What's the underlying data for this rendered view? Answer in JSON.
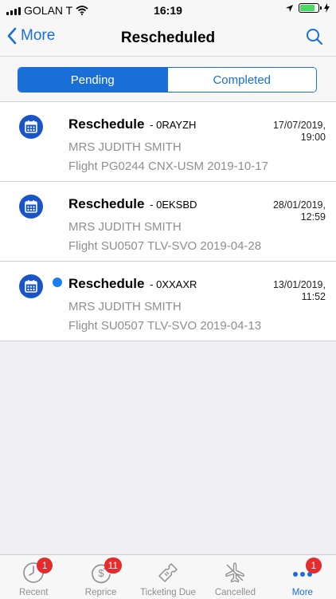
{
  "status_bar": {
    "carrier": "GOLAN T",
    "time": "16:19"
  },
  "nav": {
    "back_label": "More",
    "title": "Rescheduled"
  },
  "segments": {
    "pending": "Pending",
    "completed": "Completed",
    "selected": "Pending"
  },
  "list": {
    "items": [
      {
        "title": "Reschedule",
        "code": "- 0RAYZH",
        "date": "17/07/2019, 19:00",
        "passenger": "MRS JUDITH SMITH",
        "flight": "Flight PG0244 CNX-USM 2019-10-17",
        "unread": false
      },
      {
        "title": "Reschedule",
        "code": "- 0EKSBD",
        "date": "28/01/2019, 12:59",
        "passenger": "MRS JUDITH SMITH",
        "flight": "Flight SU0507 TLV-SVO 2019-04-28",
        "unread": false
      },
      {
        "title": "Reschedule",
        "code": "- 0XXAXR",
        "date": "13/01/2019, 11:52",
        "passenger": "MRS JUDITH SMITH",
        "flight": "Flight SU0507 TLV-SVO 2019-04-13",
        "unread": true
      }
    ]
  },
  "tabs": {
    "recent": {
      "label": "Recent",
      "badge": "1",
      "icon": "clock-icon"
    },
    "reprice": {
      "label": "Reprice",
      "badge": "11",
      "icon": "dollar-refresh-icon"
    },
    "ticketing_due": {
      "label": "Ticketing Due",
      "icon": "ticket-icon"
    },
    "cancelled": {
      "label": "Cancelled",
      "icon": "plane-cancelled-icon"
    },
    "more": {
      "label": "More",
      "badge": "1",
      "icon": "more-dots-icon"
    }
  },
  "colors": {
    "accent": "#1a6fd6",
    "badge": "#e52b2b",
    "row_icon": "#1a55c8",
    "unread_dot": "#1a7ff0"
  }
}
